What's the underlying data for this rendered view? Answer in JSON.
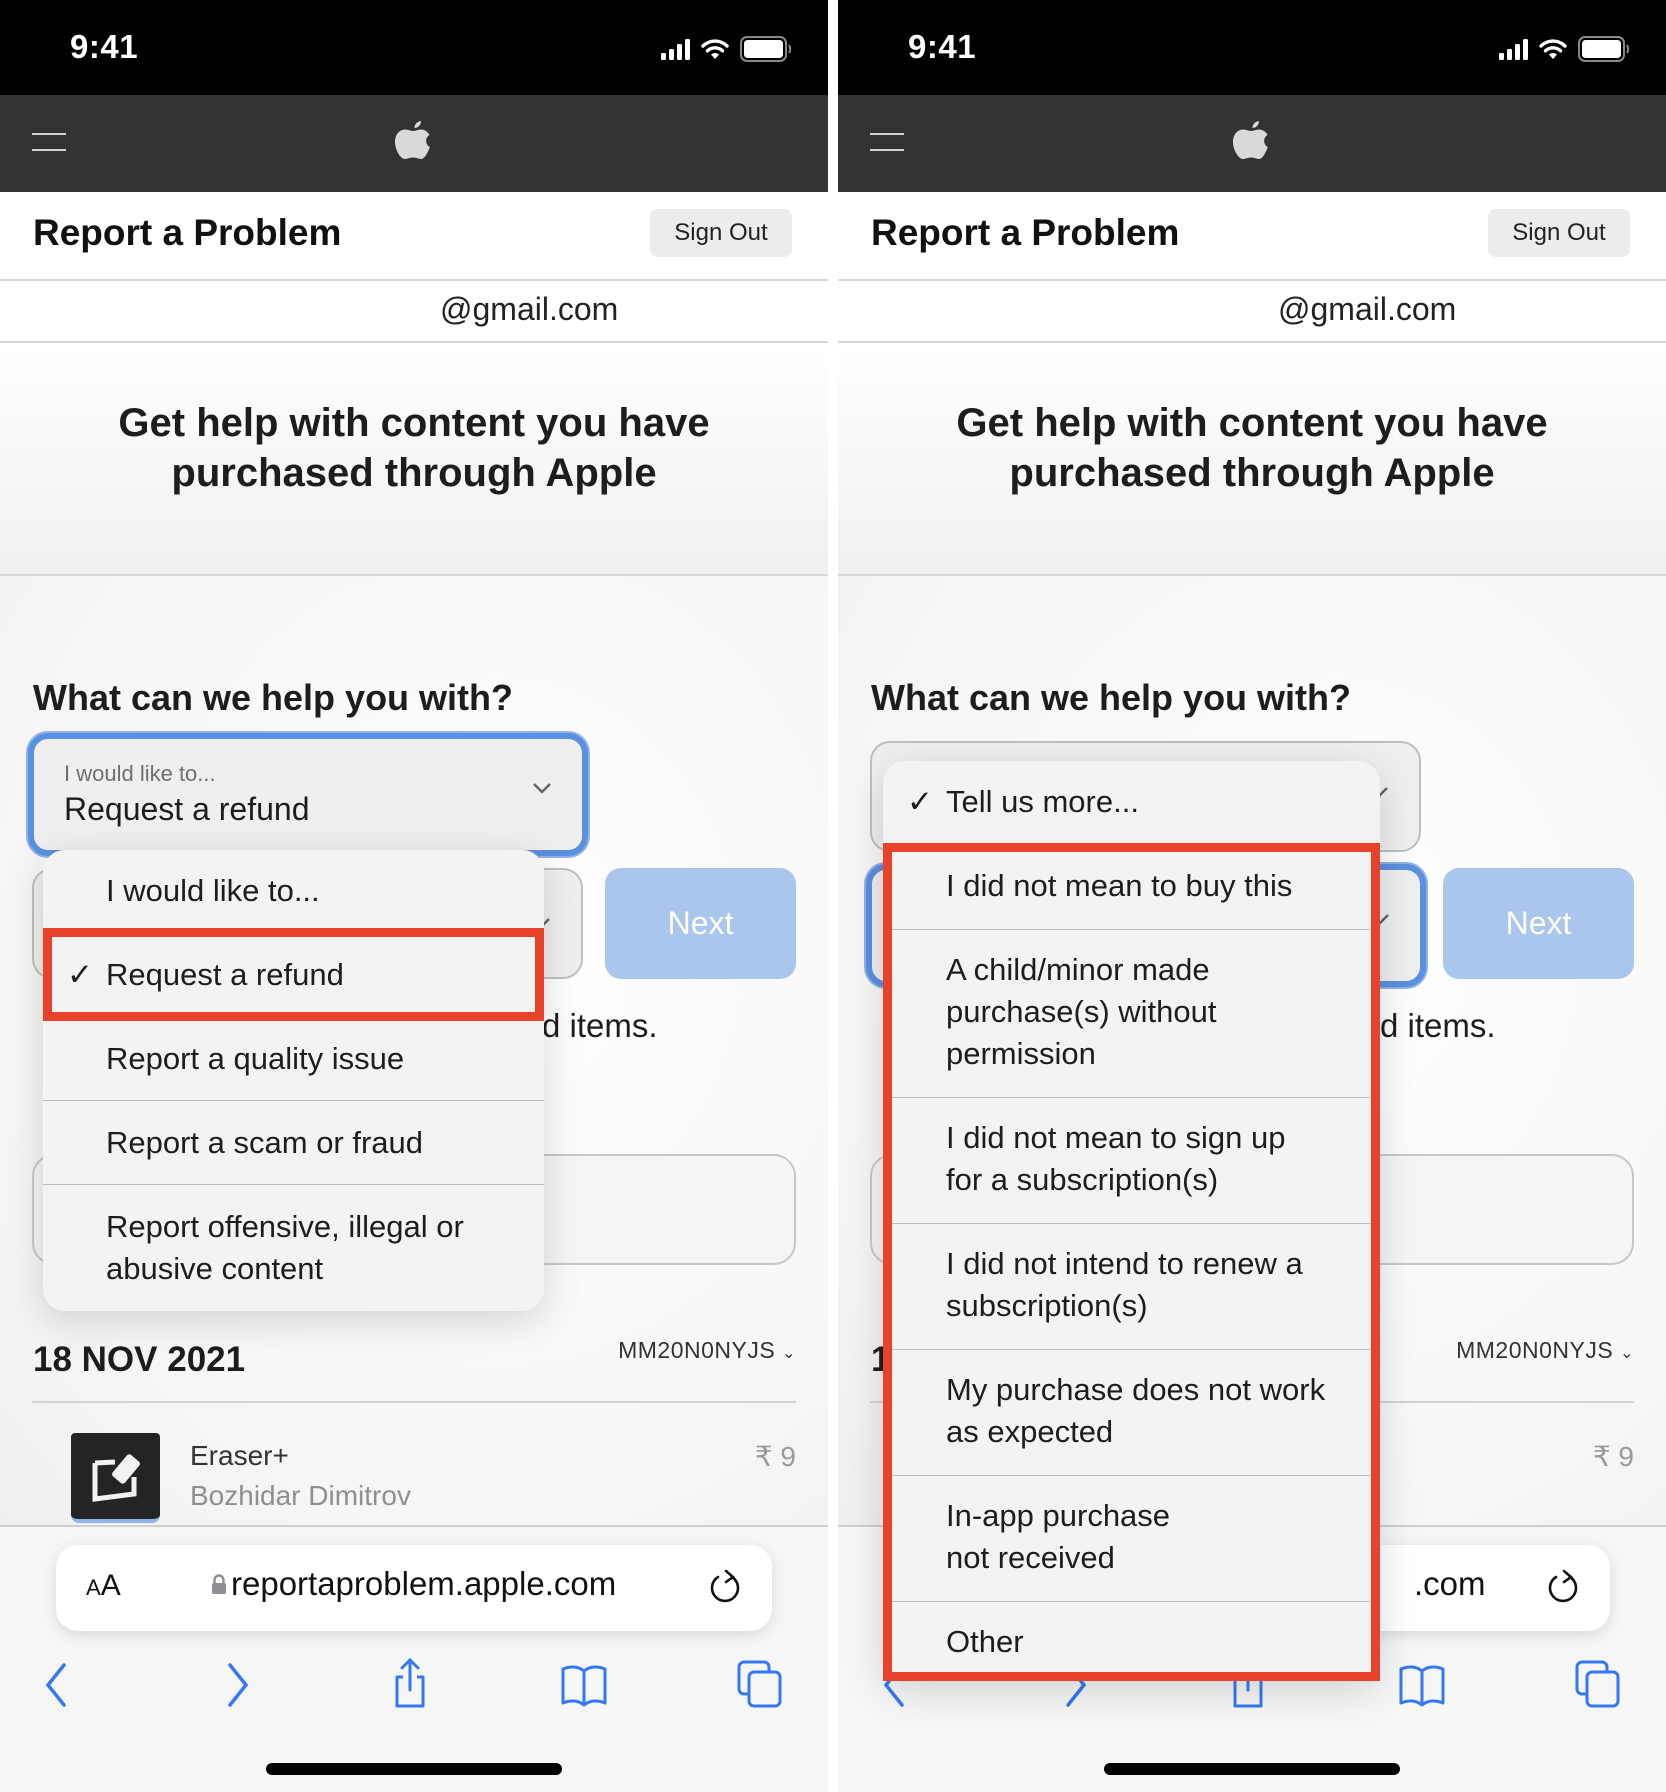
{
  "status_bar": {
    "time": "9:41",
    "icons": [
      "cellular-signal-icon",
      "wifi-icon",
      "battery-icon"
    ]
  },
  "nav": {
    "menu_icon": "hamburger-icon",
    "logo": "apple-logo-icon"
  },
  "header": {
    "title": "Report a Problem",
    "sign_out_label": "Sign Out"
  },
  "account": {
    "email": "@gmail.com"
  },
  "hero": {
    "line1": "Get help with content you have",
    "line2": "purchased through Apple"
  },
  "form": {
    "heading": "What can we help you with?",
    "select1": {
      "label": "I would like to...",
      "value": "Request a refund"
    },
    "next_label": "Next",
    "partial_text": "d items."
  },
  "purchase": {
    "date": "18 NOV 2021",
    "order_id": "MM20N0NYJS",
    "app_name": "Eraser+",
    "developer": "Bozhidar Dimitrov",
    "price": "₹ 9",
    "partial_date_char": "1"
  },
  "browser": {
    "text_size_label_small": "A",
    "text_size_label_large": "A",
    "url": "reportaproblem.apple.com",
    "url_partial": ".com",
    "toolbar": [
      "back-icon",
      "forward-icon",
      "share-icon",
      "bookmarks-icon",
      "tabs-icon"
    ]
  },
  "left_menu": {
    "items": [
      {
        "label": "I would like to...",
        "checked": false
      },
      {
        "label": "Request a refund",
        "checked": true
      },
      {
        "label": "Report a quality issue",
        "checked": false
      },
      {
        "label": "Report a scam or fraud",
        "checked": false
      },
      {
        "label_line1": "Report offensive, illegal or",
        "label_line2": "abusive content",
        "checked": false
      }
    ],
    "check_glyph": "✓"
  },
  "right_menu": {
    "items": [
      {
        "label": "Tell us more...",
        "checked": true
      },
      {
        "label": "I did not mean to buy this"
      },
      {
        "label_line1": "A child/minor made",
        "label_line2": "purchase(s) without",
        "label_line3": "permission"
      },
      {
        "label_line1": "I did not mean to sign up",
        "label_line2": "for a subscription(s)"
      },
      {
        "label_line1": "I did not intend to renew a",
        "label_line2": "subscription(s)"
      },
      {
        "label_line1": "My purchase does not work",
        "label_line2": "as expected"
      },
      {
        "label_line1": "In-app purchase",
        "label_line2": "not received"
      },
      {
        "label": "Other"
      }
    ],
    "check_glyph": "✓"
  },
  "colors": {
    "highlight": "#e8422a",
    "focus": "#5b8fdf",
    "next_button": "#aac6ec",
    "toolbar_icons": "#3478f6",
    "nav_bar": "#333333"
  }
}
